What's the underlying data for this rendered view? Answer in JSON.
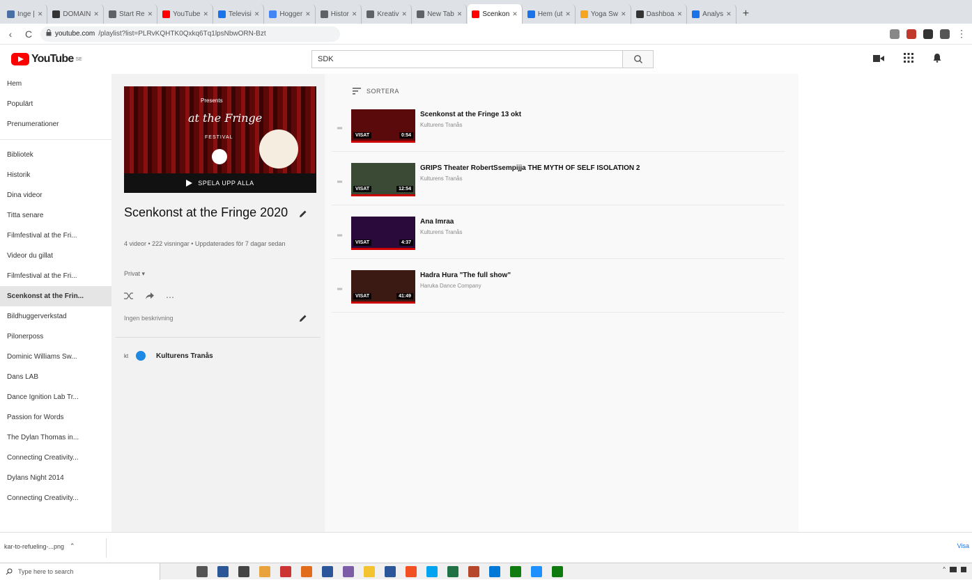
{
  "browser": {
    "tabs": [
      {
        "label": "Inge |",
        "favicon_color": "#4a6fa5"
      },
      {
        "label": "DOMAIN",
        "favicon_color": "#333333"
      },
      {
        "label": "Start Re",
        "favicon_color": "#5f6368"
      },
      {
        "label": "YouTube",
        "favicon_color": "#ff0000"
      },
      {
        "label": "Televisi",
        "favicon_color": "#1a73e8"
      },
      {
        "label": "Hogger",
        "favicon_color": "#4285f4"
      },
      {
        "label": "Histor",
        "favicon_color": "#5f6368"
      },
      {
        "label": "Kreativ",
        "favicon_color": "#5f6368"
      },
      {
        "label": "New Tab",
        "favicon_color": "#5f6368"
      },
      {
        "label": "Scenkon",
        "favicon_color": "#ff0000",
        "active": true
      },
      {
        "label": "Hem (ut",
        "favicon_color": "#1a73e8"
      },
      {
        "label": "Yoga Sw",
        "favicon_color": "#f4a623"
      },
      {
        "label": "Dashboa",
        "favicon_color": "#333333"
      },
      {
        "label": "Analys",
        "favicon_color": "#1a73e8"
      }
    ],
    "new_tab_label": "+",
    "url_domain": "youtube.com",
    "url_rest": "/playlist?list=PLRvKQHTK0Qxkq6Tq1lpsNbwORN-Bzt",
    "reload_label": "C",
    "extension_colors": [
      "#888888",
      "#c0392b",
      "#333333",
      "#555555"
    ]
  },
  "masthead": {
    "logo_text": "YouTube",
    "logo_region": "SE",
    "search_value": "SDK"
  },
  "sidebar": {
    "group1": [
      "Hem",
      "Populärt",
      "Prenumerationer"
    ],
    "group2": [
      "Bibliotek",
      "Historik",
      "Dina videor",
      "Titta senare",
      "Filmfestival at the Fri...",
      "Videor du gillat",
      "Filmfestival at the Fri...",
      "Scenkonst at the Frin...",
      "Bildhuggerverkstad",
      "Pilonerposs",
      "Dominic Williams Sw...",
      "Dans LAB",
      "Dance Ignition Lab Tr...",
      "Passion for Words",
      "The Dylan Thomas in...",
      "Connecting Creativity...",
      "Dylans Night 2014",
      "Connecting Creativity..."
    ],
    "selected_index": 7
  },
  "playlist": {
    "thumb_presents": "Presents",
    "thumb_fringe": "at the Fringe",
    "thumb_festival": "FESTIVAL",
    "play_all_label": "SPELA UPP ALLA",
    "title": "Scenkonst at the Fringe 2020",
    "meta": "4 videor • 222 visningar • Uppdaterades för 7 dagar sedan",
    "privacy": "Privat",
    "description": "Ingen beskrivning",
    "owner_name": "Kulturens Tranås",
    "sort_label": "SORTERA"
  },
  "videos": [
    {
      "title": "Scenkonst at the Fringe 13 okt",
      "channel": "Kulturens Tranås",
      "seen": "VISAT",
      "duration": "0:54",
      "thumb_color": "#5a0a0a"
    },
    {
      "title": "GRIPS Theater RobertSsempijja THE MYTH OF SELF ISOLATION 2",
      "channel": "Kulturens Tranås",
      "seen": "VISAT",
      "duration": "12:54",
      "thumb_color": "#3b4a35"
    },
    {
      "title": "Ana Imraa",
      "channel": "Kulturens Tranås",
      "seen": "VISAT",
      "duration": "4:37",
      "thumb_color": "#2a0a3a"
    },
    {
      "title": "Hadra Hura \"The full show\"",
      "channel": "Haruka Dance Company",
      "seen": "VISAT",
      "duration": "41:49",
      "thumb_color": "#3a1a12"
    }
  ],
  "downloads": {
    "file_label": "kar-to-refueling-...png",
    "show_all_label": "Visa"
  },
  "taskbar": {
    "search_placeholder": "Type here to search",
    "app_colors": [
      "#555555",
      "#2b5797",
      "#444444",
      "#e8a33d",
      "#cc3333",
      "#e06c1c",
      "#2b579a",
      "#7b5ea7",
      "#f4c430",
      "#2b579a",
      "#f25022",
      "#00a4ef",
      "#217346",
      "#b7472a",
      "#0078d7",
      "#107c10",
      "#1e90ff",
      "#0f7b0f"
    ]
  }
}
